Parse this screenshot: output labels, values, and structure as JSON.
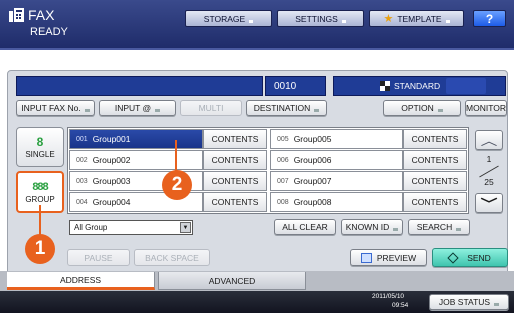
{
  "app": {
    "title": "FAX",
    "status": "READY",
    "icon": "fax-icon"
  },
  "header_buttons": {
    "storage": "STORAGE",
    "settings": "SETTINGS",
    "template": "TEMPLATE",
    "help": "?"
  },
  "counter": "0010",
  "quality": "STANDARD",
  "toolbar": {
    "input_fax": "INPUT FAX No.",
    "input_at": "INPUT @",
    "multi": "MULTI",
    "destination": "DESTINATION",
    "option": "OPTION",
    "monitor": "MONITOR"
  },
  "side_tabs": {
    "single": "SINGLE",
    "group": "GROUP"
  },
  "groups": [
    {
      "num": "001",
      "name": "Group001",
      "contents": "CONTENTS",
      "selected": true
    },
    {
      "num": "002",
      "name": "Group002",
      "contents": "CONTENTS"
    },
    {
      "num": "003",
      "name": "Group003",
      "contents": "CONTENTS"
    },
    {
      "num": "004",
      "name": "Group004",
      "contents": "CONTENTS"
    },
    {
      "num": "005",
      "name": "Group005",
      "contents": "CONTENTS"
    },
    {
      "num": "006",
      "name": "Group006",
      "contents": "CONTENTS"
    },
    {
      "num": "007",
      "name": "Group007",
      "contents": "CONTENTS"
    },
    {
      "num": "008",
      "name": "Group008",
      "contents": "CONTENTS"
    }
  ],
  "pager": {
    "current": "1",
    "total": "25"
  },
  "filter": {
    "selected": "All Group"
  },
  "actions": {
    "all_clear": "ALL CLEAR",
    "known_id": "KNOWN ID",
    "search": "SEARCH"
  },
  "bottom": {
    "pause": "PAUSE",
    "back_space": "BACK SPACE",
    "preview": "PREVIEW",
    "send": "SEND"
  },
  "tabs": {
    "address": "ADDRESS",
    "advanced": "ADVANCED"
  },
  "footer": {
    "date": "2011/05/10",
    "time": "09:54",
    "job_status": "JOB STATUS"
  },
  "callouts": {
    "one": "1",
    "two": "2"
  },
  "colors": {
    "header": "#23306e",
    "selected_row": "#1f3c96",
    "callout": "#e8611e",
    "send": "#46c8b4"
  }
}
